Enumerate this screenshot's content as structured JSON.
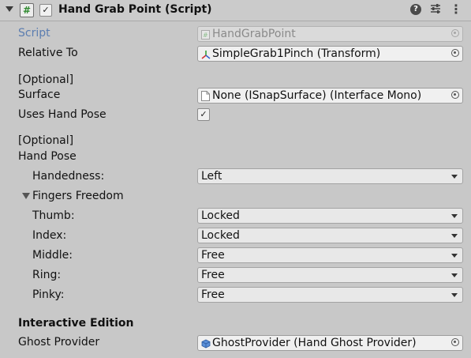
{
  "header": {
    "title": "Hand Grab Point (Script)",
    "enabled_check": "✓",
    "script_icon": "#"
  },
  "fields": {
    "script": {
      "label": "Script",
      "value": "HandGrabPoint"
    },
    "relative_to": {
      "label": "Relative To",
      "value": "SimpleGrab1Pinch (Transform)"
    },
    "surface_optional": "[Optional]",
    "surface": {
      "label": "Surface",
      "value": "None (ISnapSurface) (Interface Mono)"
    },
    "uses_hand_pose": {
      "label": "Uses Hand Pose",
      "checked": "✓"
    },
    "hand_pose_optional": "[Optional]",
    "hand_pose_label": "Hand Pose",
    "handedness": {
      "label": "Handedness:",
      "value": "Left"
    },
    "fingers_freedom_label": "Fingers Freedom",
    "thumb": {
      "label": "Thumb:",
      "value": "Locked"
    },
    "index": {
      "label": "Index:",
      "value": "Locked"
    },
    "middle": {
      "label": "Middle:",
      "value": "Free"
    },
    "ring": {
      "label": "Ring:",
      "value": "Free"
    },
    "pinky": {
      "label": "Pinky:",
      "value": "Free"
    },
    "interactive_edition_label": "Interactive Edition",
    "ghost_provider": {
      "label": "Ghost Provider",
      "value": "GhostProvider (Hand Ghost Provider)"
    }
  },
  "icons": {
    "foldout": "triangle-down-icon",
    "script": "script-hash-icon",
    "help": "help-icon",
    "presets": "sliders-icon",
    "more": "kebab-menu-icon",
    "object_picker": "target-circle-icon",
    "transform": "transform-axes-icon",
    "document": "document-icon",
    "ghost_provider": "prefab-cube-icon"
  },
  "colors": {
    "background": "#c8c8c8",
    "disabled_label": "#5b7db0",
    "script_icon_green": "#2f8a2f"
  }
}
